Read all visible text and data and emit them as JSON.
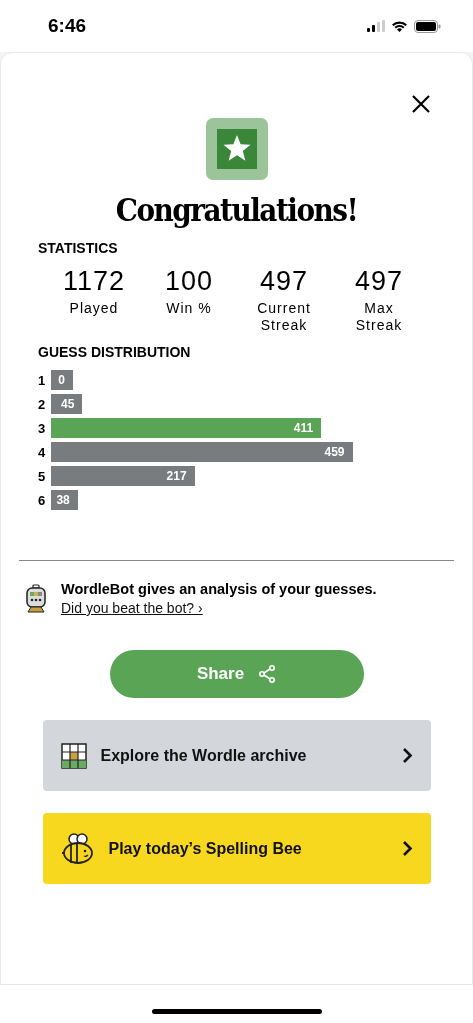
{
  "status_bar": {
    "time": "6:46"
  },
  "title": "Congratulations!",
  "statistics": {
    "heading": "STATISTICS",
    "items": [
      {
        "value": "1172",
        "label": "Played"
      },
      {
        "value": "100",
        "label": "Win %"
      },
      {
        "value": "497",
        "label": "Current Streak"
      },
      {
        "value": "497",
        "label": "Max Streak"
      }
    ]
  },
  "guess_distribution": {
    "heading": "GUESS DISTRIBUTION",
    "rows": [
      {
        "guess": "1",
        "count": "0",
        "selected": false
      },
      {
        "guess": "2",
        "count": "45",
        "selected": false
      },
      {
        "guess": "3",
        "count": "411",
        "selected": true
      },
      {
        "guess": "4",
        "count": "459",
        "selected": false
      },
      {
        "guess": "5",
        "count": "217",
        "selected": false
      },
      {
        "guess": "6",
        "count": "38",
        "selected": false
      }
    ]
  },
  "wordlebot": {
    "text": "WordleBot gives an analysis of your guesses.",
    "link": "Did you beat the bot? ›"
  },
  "share_button": "Share",
  "promos": [
    {
      "kind": "archive",
      "label": "Explore the Wordle archive"
    },
    {
      "kind": "bee",
      "label": "Play today’s Spelling Bee"
    }
  ]
}
